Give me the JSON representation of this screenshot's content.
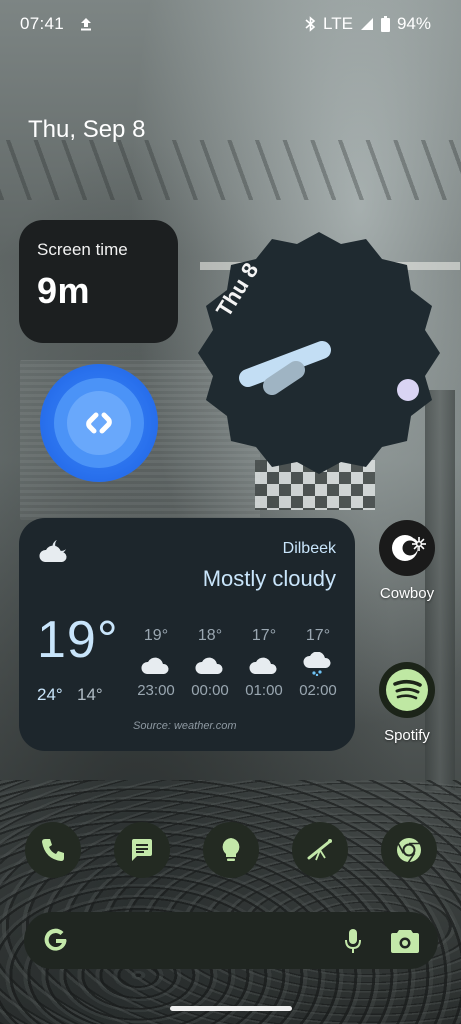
{
  "status_bar": {
    "time": "07:41",
    "network": "LTE",
    "battery": "94%",
    "icons": [
      "upload-icon",
      "bluetooth-icon",
      "signal-icon",
      "battery-icon"
    ]
  },
  "date": "Thu, Sep 8",
  "screen_time": {
    "title": "Screen time",
    "value": "9m"
  },
  "shazam": {
    "icon": "shazam-icon"
  },
  "clock": {
    "date": "Thu 8"
  },
  "weather": {
    "city": "Dilbeek",
    "condition": "Mostly cloudy",
    "temperature": "19°",
    "high": "24°",
    "low": "14°",
    "hourly": [
      {
        "temp": "19°",
        "time": "23:00",
        "icon": "cloud-icon"
      },
      {
        "temp": "18°",
        "time": "00:00",
        "icon": "cloud-icon"
      },
      {
        "temp": "17°",
        "time": "01:00",
        "icon": "cloud-icon"
      },
      {
        "temp": "17°",
        "time": "02:00",
        "icon": "rain-icon"
      }
    ],
    "source": "Source: weather.com"
  },
  "apps": {
    "cowboy": {
      "label": "Cowboy"
    },
    "spotify": {
      "label": "Spotify"
    }
  },
  "dock": [
    "phone-icon",
    "messages-icon",
    "bulb-icon",
    "telescope-icon",
    "chrome-icon"
  ],
  "search": {
    "icons": [
      "google-g-icon",
      "mic-icon",
      "lens-icon"
    ]
  },
  "colors": {
    "accent_blue": "#c9e5fb",
    "accent_green": "#c3e8a9",
    "widget_dark": "#1d262c"
  }
}
